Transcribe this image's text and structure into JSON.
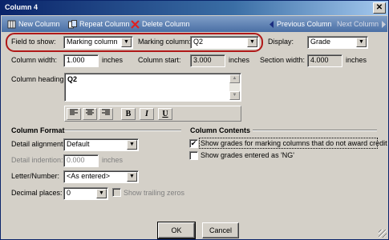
{
  "window": {
    "title": "Column 4",
    "close_label": "✕"
  },
  "toolbar": {
    "new_column": "New Column",
    "repeat_column": "Repeat Column",
    "delete_column": "Delete Column",
    "previous_column": "Previous Column",
    "next_column": "Next Column"
  },
  "form": {
    "field_to_show_label": "Field to show:",
    "field_to_show_value": "Marking column",
    "marking_column_label": "Marking column:",
    "marking_column_value": "Q2",
    "display_label": "Display:",
    "display_value": "Grade",
    "column_width_label": "Column width:",
    "column_width_value": "1.000",
    "column_width_unit": "inches",
    "column_start_label": "Column start:",
    "column_start_value": "3.000",
    "column_start_unit": "inches",
    "section_width_label": "Section width:",
    "section_width_value": "4.000",
    "section_width_unit": "inches",
    "column_heading_label": "Column heading:",
    "column_heading_value": "Q2"
  },
  "format_toolbar": {
    "bold": "B",
    "italic": "I",
    "underline": "U"
  },
  "column_format": {
    "title": "Column Format",
    "detail_alignment_label": "Detail alignment:",
    "detail_alignment_value": "Default",
    "detail_indention_label": "Detail indention:",
    "detail_indention_value": "0.000",
    "detail_indention_unit": "inches",
    "letter_number_label": "Letter/Number:",
    "letter_number_value": "<As entered>",
    "decimal_places_label": "Decimal places:",
    "decimal_places_value": "0",
    "show_trailing_zeros_label": "Show trailing zeros"
  },
  "column_contents": {
    "title": "Column Contents",
    "option1_label": "Show grades for marking columns that do not award credit",
    "option1_checked": true,
    "option2_label": "Show grades entered as 'NG'",
    "option2_checked": false
  },
  "buttons": {
    "ok": "OK",
    "cancel": "Cancel"
  },
  "colors": {
    "highlight": "#b01818",
    "titlebar": "#0a246a",
    "toolbar": "#4a6fa5"
  }
}
